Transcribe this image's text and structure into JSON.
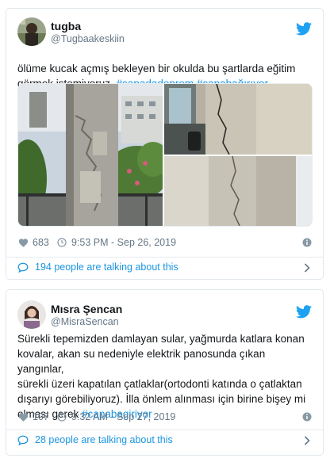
{
  "tweets": [
    {
      "display_name": "tugba",
      "handle": "@Tugbaakeskiin",
      "text_lines": [
        [
          {
            "t": "ölüme kucak açmış bekleyen bir okulda bu şartlarda eğitim"
          }
        ],
        [
          {
            "t": "görmek istemiyoruz. "
          },
          {
            "t": "#çapadadeprem",
            "tag": true
          },
          {
            "t": " "
          },
          {
            "t": "#çapabağırıyor",
            "tag": true
          }
        ]
      ],
      "likes": "683",
      "timestamp": "9:53 PM - Sep 26, 2019",
      "talking": "194 people are talking about this",
      "icons": {
        "bird": "twitter-bird-icon",
        "heart": "heart-icon",
        "clock": "clock-icon",
        "info": "info-icon",
        "bubble": "speech-bubble-icon",
        "chevron": "chevron-right-icon"
      }
    },
    {
      "display_name": "Mısra Şencan",
      "handle": "@MisraSencan",
      "text_lines": [
        [
          {
            "t": "Sürekli tepemizden damlayan sular, yağmurda katlara konan"
          }
        ],
        [
          {
            "t": "kovalar, akan su nedeniyle elektrik panosunda çıkan yangınlar,"
          }
        ],
        [
          {
            "t": "sürekli üzeri kapatılan çatlaklar(ortodonti katında o çatlaktan"
          }
        ],
        [
          {
            "t": "dışarıyı görebiliyoruz). İlla önlem alınması için birine bişey mi"
          }
        ],
        [
          {
            "t": "olması gerek "
          },
          {
            "t": "#capabagiriyor",
            "tag": true
          }
        ]
      ],
      "likes": "107",
      "timestamp": "9:32 AM - Sep 27, 2019",
      "talking": "28 people are talking about this"
    }
  ],
  "colors": {
    "link": "#1b95e0",
    "muted": "#657786",
    "text": "#14171a",
    "border": "#e1e8ed",
    "heart": "#8899a6"
  }
}
